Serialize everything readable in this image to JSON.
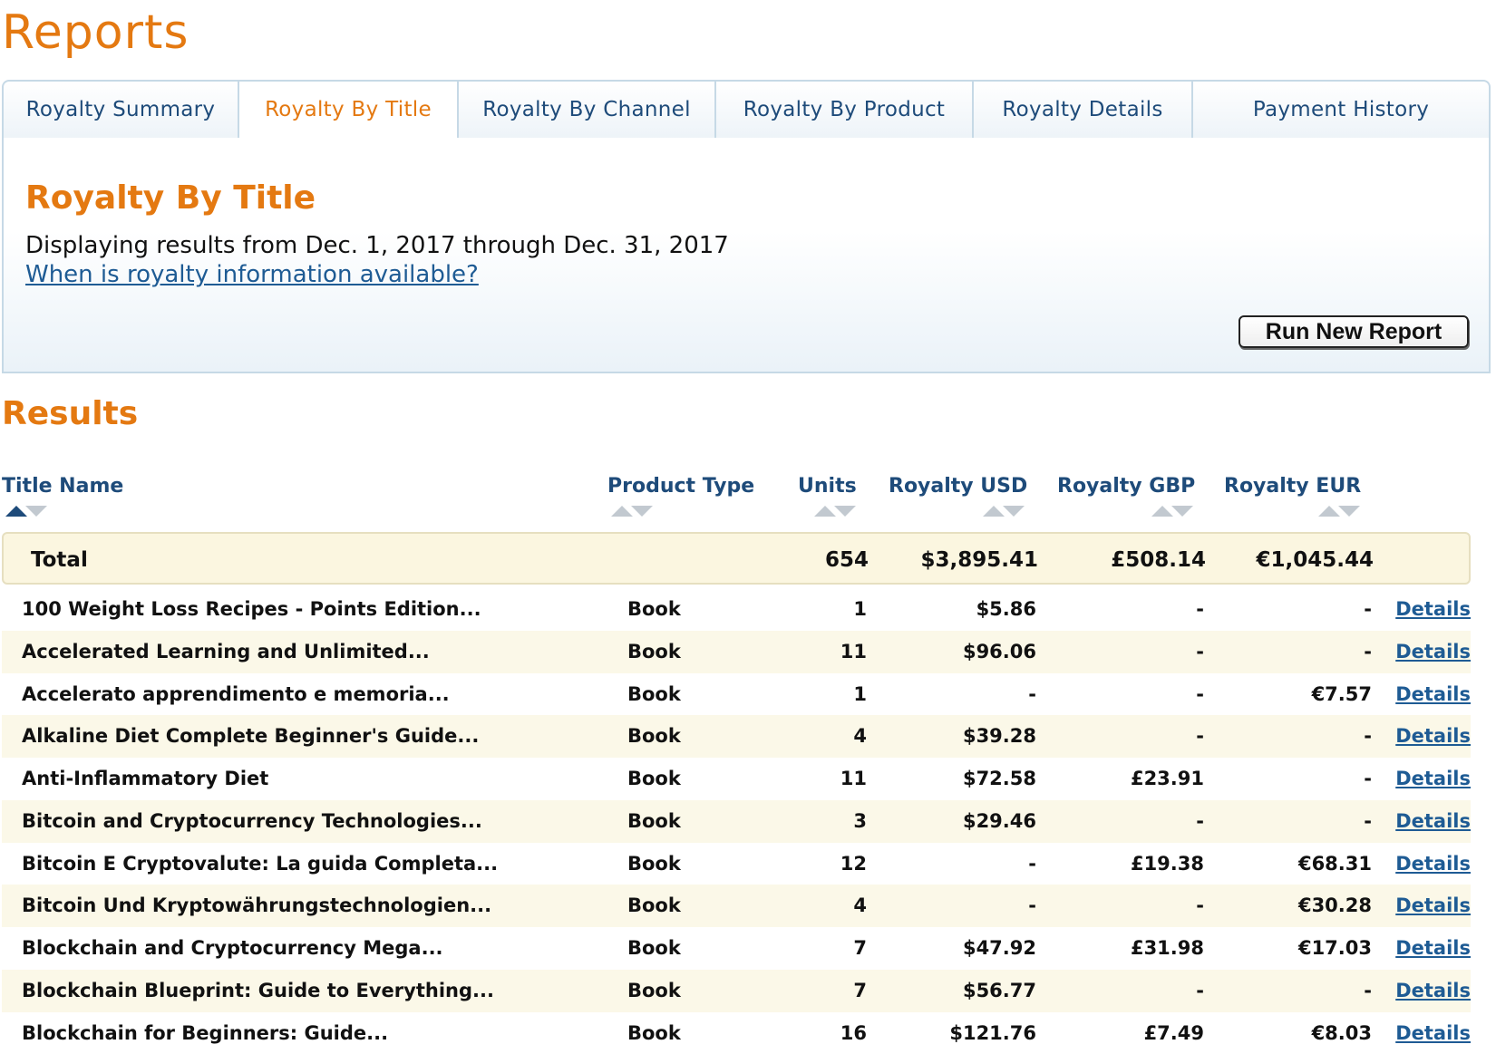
{
  "page": {
    "title": "Reports"
  },
  "tabs": [
    {
      "label": "Royalty Summary",
      "active": false
    },
    {
      "label": "Royalty By Title",
      "active": true
    },
    {
      "label": "Royalty By Channel",
      "active": false
    },
    {
      "label": "Royalty By Product",
      "active": false
    },
    {
      "label": "Royalty Details",
      "active": false
    },
    {
      "label": "Payment History",
      "active": false
    }
  ],
  "panel": {
    "title": "Royalty By Title",
    "range_text": "Displaying results from Dec. 1, 2017 through Dec. 31, 2017",
    "help_link": "When is royalty information available?",
    "run_button": "Run New Report"
  },
  "results": {
    "title": "Results",
    "columns": {
      "title": "Title Name",
      "type": "Product Type",
      "units": "Units",
      "usd": "Royalty USD",
      "gbp": "Royalty GBP",
      "eur": "Royalty EUR"
    },
    "sort": {
      "column": "title",
      "direction": "ascending"
    },
    "total": {
      "label": "Total",
      "units": "654",
      "usd": "$3,895.41",
      "gbp": "£508.14",
      "eur": "€1,045.44"
    },
    "details_label": "Details",
    "rows": [
      {
        "title": "100 Weight Loss Recipes - Points Edition...",
        "type": "Book",
        "units": "1",
        "usd": "$5.86",
        "gbp": "-",
        "eur": "-"
      },
      {
        "title": "Accelerated Learning and Unlimited...",
        "type": "Book",
        "units": "11",
        "usd": "$96.06",
        "gbp": "-",
        "eur": "-"
      },
      {
        "title": "Accelerato apprendimento e memoria...",
        "type": "Book",
        "units": "1",
        "usd": "-",
        "gbp": "-",
        "eur": "€7.57"
      },
      {
        "title": "Alkaline Diet Complete Beginner's Guide...",
        "type": "Book",
        "units": "4",
        "usd": "$39.28",
        "gbp": "-",
        "eur": "-"
      },
      {
        "title": "Anti-Inflammatory Diet",
        "type": "Book",
        "units": "11",
        "usd": "$72.58",
        "gbp": "£23.91",
        "eur": "-"
      },
      {
        "title": "Bitcoin and Cryptocurrency Technologies...",
        "type": "Book",
        "units": "3",
        "usd": "$29.46",
        "gbp": "-",
        "eur": "-"
      },
      {
        "title": "Bitcoin E Cryptovalute: La guida Completa...",
        "type": "Book",
        "units": "12",
        "usd": "-",
        "gbp": "£19.38",
        "eur": "€68.31"
      },
      {
        "title": "Bitcoin Und Kryptowährungstechnologien...",
        "type": "Book",
        "units": "4",
        "usd": "-",
        "gbp": "-",
        "eur": "€30.28"
      },
      {
        "title": "Blockchain and Cryptocurrency Mega...",
        "type": "Book",
        "units": "7",
        "usd": "$47.92",
        "gbp": "£31.98",
        "eur": "€17.03"
      },
      {
        "title": "Blockchain Blueprint: Guide to Everything...",
        "type": "Book",
        "units": "7",
        "usd": "$56.77",
        "gbp": "-",
        "eur": "-"
      },
      {
        "title": "Blockchain for Beginners: Guide...",
        "type": "Book",
        "units": "16",
        "usd": "$121.76",
        "gbp": "£7.49",
        "eur": "€8.03"
      }
    ]
  }
}
